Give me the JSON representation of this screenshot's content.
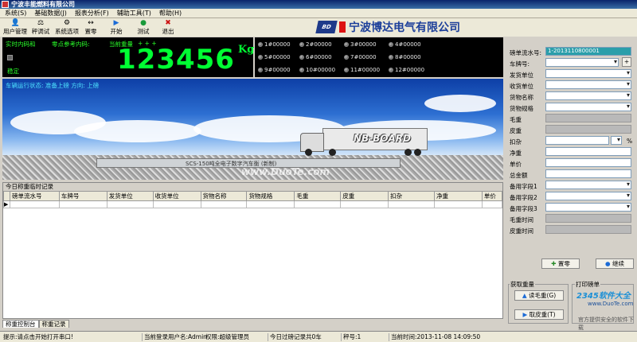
{
  "window": {
    "title": "宁波丰能燃料有限公司"
  },
  "menu": [
    "系统(S)",
    "基础数据(J)",
    "报表分析(F)",
    "辅助工具(T)",
    "帮助(H)"
  ],
  "toolbar": [
    "用户管理",
    "秤调试",
    "系统选项",
    "置零",
    "开始",
    "测试",
    "退出"
  ],
  "logo": {
    "mark": "BD",
    "company": "宁波博达电气有限公司"
  },
  "weigh": {
    "realtime_label": "实时内码和",
    "zero_label": "零点参考内码:",
    "current_label": "当前重量",
    "value": "123456",
    "unit": "Kg",
    "stable_label": "稳定"
  },
  "leds": [
    "1#00000",
    "2#00000",
    "3#00000",
    "4#00000",
    "5#00000",
    "6#00000",
    "7#00000",
    "8#00000",
    "9#00000",
    "10#00000",
    "11#00000",
    "12#00000"
  ],
  "scene": {
    "status": "车辆运行状态: 准备上磅   方向: 上磅",
    "truck_text": "NB-BOARD",
    "platform_caption": "SCS-150吨全电子数字汽车衡 (新制)",
    "watermark": "www.DuoTe.com"
  },
  "records": {
    "title": "今日称重临时记录",
    "columns": [
      "磅单流水号",
      "车牌号",
      "发货单位",
      "收货单位",
      "货物名称",
      "货物规格",
      "毛重",
      "皮重",
      "扣杂",
      "净重",
      "单价"
    ]
  },
  "tabs": [
    "称重控制台",
    "称重记录"
  ],
  "form": {
    "serial_label": "磅单流水号:",
    "serial_value": "1-2013110800001",
    "fields": [
      "车牌号:",
      "发货单位",
      "收货单位",
      "货物名称",
      "货物规格",
      "毛重",
      "皮重",
      "扣杂",
      "净重",
      "单价",
      "总金额",
      "备用字段1",
      "备用字段2",
      "备用字段3",
      "毛重时间",
      "皮重时间"
    ],
    "deduct_unit": "%",
    "zero_btn": "置零",
    "continue_btn": "继续",
    "get_weight_label": "获取重量",
    "print_label": "打印磅单",
    "gross_btn": "读毛重(G)",
    "tare_btn": "取皮重(T)"
  },
  "statusbar": {
    "hint": "提示:请点击开始打开串口!",
    "user": "当前登录用户名:Admin",
    "role": "权限:超级管理员",
    "count": "今日过磅记录共0车",
    "scale": "秤号:1",
    "time": "当前时间:2013-11-08 14:09:50"
  },
  "watermark_site": "2345软件大全",
  "watermark_line2": "www.DuoTe.com",
  "watermark_line3": "官方提供安全的软件下载"
}
